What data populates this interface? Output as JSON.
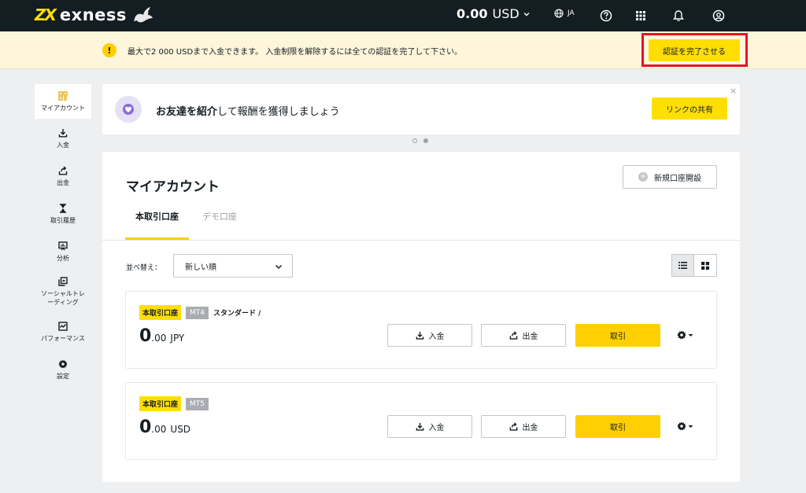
{
  "brand": {
    "name": "exness",
    "mark": "ZX"
  },
  "header": {
    "balance_amount": "0.00",
    "balance_currency": "USD",
    "language": "JA",
    "icons": [
      "globe-icon",
      "help-icon",
      "apps-grid-icon",
      "bell-icon",
      "user-icon"
    ]
  },
  "notice": {
    "icon": "!",
    "text": "最大で2 000 USDまで入金できます。 入金制限を解除するには全ての認証を完了して下さい。",
    "button_label": "認証を完了させる"
  },
  "sidebar": {
    "items": [
      {
        "label": "マイアカウント",
        "icon": "accounts-grid-icon",
        "active": true
      },
      {
        "label": "入金",
        "icon": "deposit-icon"
      },
      {
        "label": "出金",
        "icon": "withdraw-icon"
      },
      {
        "label": "取引履歴",
        "icon": "hourglass-icon"
      },
      {
        "label": "分析",
        "icon": "analytics-icon"
      },
      {
        "label": "ソーシャルトレーディング",
        "label_line1": "ソーシャルトレ",
        "label_line2": "ーディング",
        "icon": "social-trading-icon"
      },
      {
        "label": "パフォーマンス",
        "icon": "performance-icon"
      },
      {
        "label": "設定",
        "icon": "gear-icon"
      }
    ]
  },
  "promo": {
    "text_bold": "お友達を紹介",
    "text_rest": "して報酬を獲得しましょう",
    "button_label": "リンクの共有",
    "close": "×"
  },
  "main": {
    "title": "マイアカウント",
    "new_account_label": "新規口座開設",
    "tabs": [
      {
        "label": "本取引口座",
        "active": true
      },
      {
        "label": "デモ口座",
        "active": false
      }
    ],
    "sort_label": "並べ替え：",
    "sort_value": "新しい順",
    "accounts": [
      {
        "type_badge": "本取引口座",
        "platform": "MT4",
        "name": "スタンダード /",
        "balance_int": "0",
        "balance_dec": ".00",
        "currency": "JPY",
        "deposit_label": "入金",
        "withdraw_label": "出金",
        "trade_label": "取引"
      },
      {
        "type_badge": "本取引口座",
        "platform": "MT5",
        "name": "",
        "balance_int": "0",
        "balance_dec": ".00",
        "currency": "USD",
        "deposit_label": "入金",
        "withdraw_label": "出金",
        "trade_label": "取引"
      }
    ]
  },
  "colors": {
    "brand_yellow": "#ffde02",
    "topbar": "#141d22",
    "notice_bg": "#fdf6da",
    "highlight_red": "#e8102c"
  }
}
